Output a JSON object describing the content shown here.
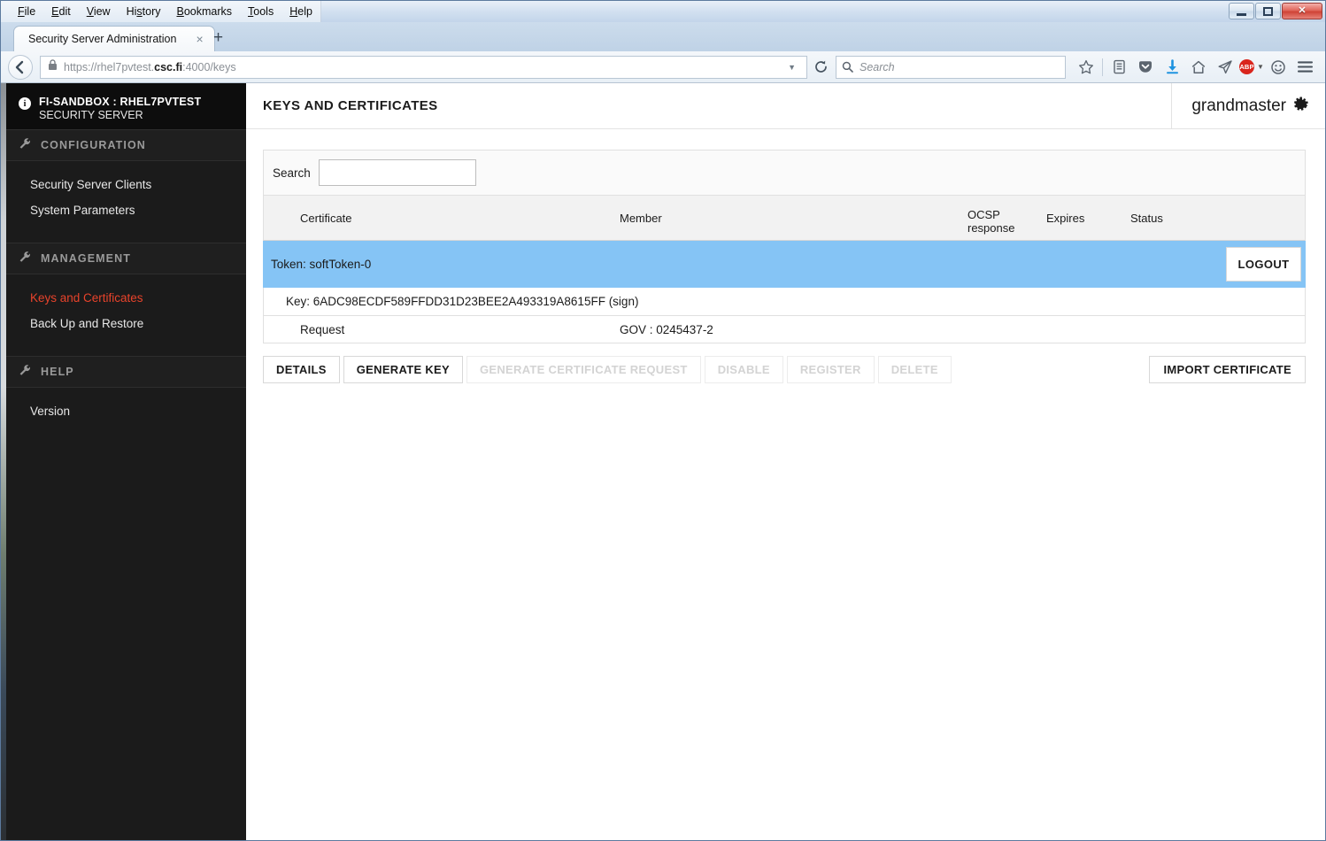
{
  "browser": {
    "menu_items": [
      "File",
      "Edit",
      "View",
      "History",
      "Bookmarks",
      "Tools",
      "Help"
    ],
    "window_controls": {
      "minimize": "minimize",
      "restore": "restore",
      "close": "✕"
    },
    "tab": {
      "title": "Security Server Administration",
      "close": "×",
      "new_tab": "+"
    },
    "url": {
      "scheme_host_pre": "https://rhel7pvtest.",
      "host_bold": "csc.fi",
      "path": ":4000/keys"
    },
    "search": {
      "placeholder": "Search"
    },
    "toolbar_icons": [
      "star-icon",
      "reading-list-icon",
      "pocket-icon",
      "download-icon",
      "home-icon",
      "send-tab-icon",
      "adblock-plus-icon",
      "feedback-smiley-icon",
      "hamburger-menu-icon"
    ],
    "adblock_label": "ABP"
  },
  "sidebar": {
    "header": {
      "line1": "FI-SANDBOX : RHEL7PVTEST",
      "line2": "SECURITY SERVER"
    },
    "sections": [
      {
        "label": "CONFIGURATION",
        "items": [
          {
            "label": "Security Server Clients",
            "active": false
          },
          {
            "label": "System Parameters",
            "active": false
          }
        ]
      },
      {
        "label": "MANAGEMENT",
        "items": [
          {
            "label": "Keys and Certificates",
            "active": true
          },
          {
            "label": "Back Up and Restore",
            "active": false
          }
        ]
      },
      {
        "label": "HELP",
        "items": [
          {
            "label": "Version",
            "active": false
          }
        ]
      }
    ]
  },
  "header": {
    "title": "KEYS AND CERTIFICATES",
    "user": "grandmaster"
  },
  "main": {
    "search": {
      "label": "Search",
      "value": "",
      "placeholder": ""
    },
    "table": {
      "columns": [
        "Certificate",
        "Member",
        "OCSP response",
        "Expires",
        "Status"
      ],
      "ocsp_line1": "OCSP",
      "ocsp_line2": "response",
      "token_row": {
        "label": "Token: softToken-0",
        "logout_label": "LOGOUT"
      },
      "key_row": {
        "label": "Key: 6ADC98ECDF589FFDD31D23BEE2A493319A8615FF (sign)"
      },
      "request_row": {
        "certificate": "Request",
        "member": "GOV : 0245437-2"
      }
    },
    "buttons": [
      {
        "label": "DETAILS",
        "disabled": false
      },
      {
        "label": "GENERATE KEY",
        "disabled": false
      },
      {
        "label": "GENERATE CERTIFICATE REQUEST",
        "disabled": true
      },
      {
        "label": "DISABLE",
        "disabled": true
      },
      {
        "label": "REGISTER",
        "disabled": true
      },
      {
        "label": "DELETE",
        "disabled": true
      }
    ],
    "import_button": {
      "label": "IMPORT CERTIFICATE",
      "disabled": false
    }
  },
  "colors": {
    "sidebar_bg": "#1b1b1b",
    "sidebar_header_bg": "#0d0d0d",
    "active_link": "#e8432b",
    "row_highlight": "#85c4f5",
    "table_head_bg": "#f2f2f2"
  }
}
